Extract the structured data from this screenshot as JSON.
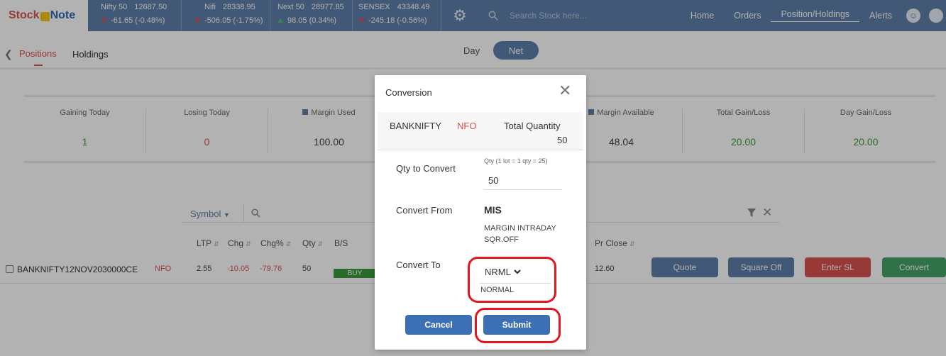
{
  "header": {
    "logo_part1": "Stock",
    "logo_part2": "Note",
    "indices": [
      {
        "name": "Nifty 50",
        "value": "12687.50",
        "change": "-61.65 (-0.48%)",
        "dir": "down"
      },
      {
        "name": "Nifi",
        "value": "28338.95",
        "change": "-506.05 (-1.75%)",
        "dir": "down"
      },
      {
        "name": "Next 50",
        "value": "28977.85",
        "change": "98.05 (0.34%)",
        "dir": "up"
      },
      {
        "name": "SENSEX",
        "value": "43348.49",
        "change": "-245.18 (-0.56%)",
        "dir": "down"
      }
    ],
    "search_placeholder": "Search Stock here...",
    "nav": {
      "home": "Home",
      "orders": "Orders",
      "positions": "Position/Holdings",
      "alerts": "Alerts"
    }
  },
  "tabs": {
    "positions": "Positions",
    "holdings": "Holdings",
    "day": "Day",
    "net": "Net"
  },
  "summary": [
    {
      "label": "Gaining Today",
      "value": "1"
    },
    {
      "label": "Losing Today",
      "value": "0"
    },
    {
      "label": "Margin Used",
      "value": "100.00"
    },
    {
      "label": "Margin Available",
      "value": "48.04"
    },
    {
      "label": "Total Gain/Loss",
      "value": "20.00"
    },
    {
      "label": "Day Gain/Loss",
      "value": "20.00"
    }
  ],
  "filter": {
    "symbol_label": "Symbol"
  },
  "table": {
    "headers": {
      "ltp": "LTP",
      "chg": "Chg",
      "chgp": "Chg%",
      "qty": "Qty",
      "bs": "B/S",
      "prclose": "Pr Close"
    },
    "row": {
      "symbol": "BANKNIFTY12NOV2030000CE",
      "exchange": "NFO",
      "ltp": "2.55",
      "chg": "-10.05",
      "chgp": "-79.76",
      "qty": "50",
      "side": "BUY",
      "prclose": "12.60"
    },
    "actions": {
      "quote": "Quote",
      "square_off": "Square Off",
      "enter_sl": "Enter SL",
      "convert": "Convert"
    }
  },
  "modal": {
    "title": "Conversion",
    "symbol": "BANKNIFTY",
    "exchange": "NFO",
    "total_qty_label": "Total Quantity",
    "total_qty": "50",
    "qty_label": "Qty to Convert",
    "qty_hint": "Qty (1 lot = 1 qty = 25)",
    "qty_value": "50",
    "from_label": "Convert From",
    "from_value": "MIS",
    "from_desc": "MARGIN INTRADAY SQR.OFF",
    "to_label": "Convert To",
    "to_value": "NRML",
    "to_desc": "NORMAL",
    "cancel": "Cancel",
    "submit": "Submit"
  },
  "colors": {
    "primary": "#5d7ea9",
    "negative": "#d9534f",
    "positive": "#3c9a3c",
    "highlight": "#e3161e"
  }
}
